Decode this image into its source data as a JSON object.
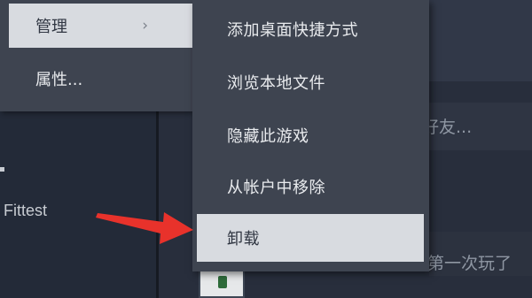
{
  "background": {
    "comment_fragment": "好友...",
    "user_name": "Fittest",
    "playtime_fragment": "第一次玩了"
  },
  "main_menu": {
    "items": [
      {
        "label": "管理",
        "has_submenu": true
      },
      {
        "label": "属性..."
      }
    ],
    "chevron_glyph": "›"
  },
  "submenu": {
    "items": [
      {
        "label": "添加桌面快捷方式"
      },
      {
        "label": "浏览本地文件"
      },
      {
        "label": "隐藏此游戏"
      },
      {
        "label": "从帐户中移除"
      },
      {
        "label": "卸载",
        "highlighted": true
      }
    ]
  },
  "annotation": {
    "arrow_color": "#e8322b",
    "points_to": "卸载"
  },
  "colors": {
    "menu_bg": "#3e4450",
    "menu_highlight": "#d8dbe0",
    "menu_text": "#e9ebee"
  }
}
